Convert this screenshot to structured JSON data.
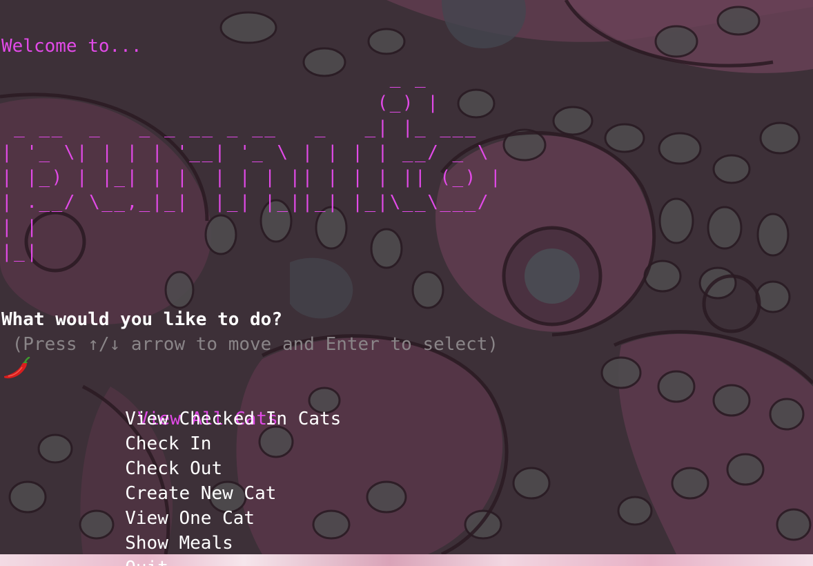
{
  "terminal": {
    "welcome": "Welcome to...",
    "logo_ascii": "                               _ _\n                              (_) |\n _ __  _   _ _ __ _ __   _   _| |_ ___\n| '_ \\| | | | '__| '_ \\ | | | | __/ _ \\\n| |_) | |_| | |  | | | || | | | || (_) |\n| .__/ \\__,_|_|  |_| |_||_| |_|\\__\\___/\n| |\n|_|",
    "prompt": {
      "question": "What would you like to do?",
      "hint": " (Press ↑/↓ arrow to move and Enter to select)"
    },
    "menu": {
      "pointer_icon": "chili-pepper-icon",
      "selected_index": 0,
      "items": [
        "View All Cats",
        "View Checked In Cats",
        "Check In",
        "Check Out",
        "Create New Cat",
        "View One Cat",
        "Show Meals",
        "Quit"
      ]
    },
    "colors": {
      "accent": "#e24ae8",
      "text": "#ffffff",
      "hint": "#8a8588",
      "background": "#3d3038"
    }
  }
}
